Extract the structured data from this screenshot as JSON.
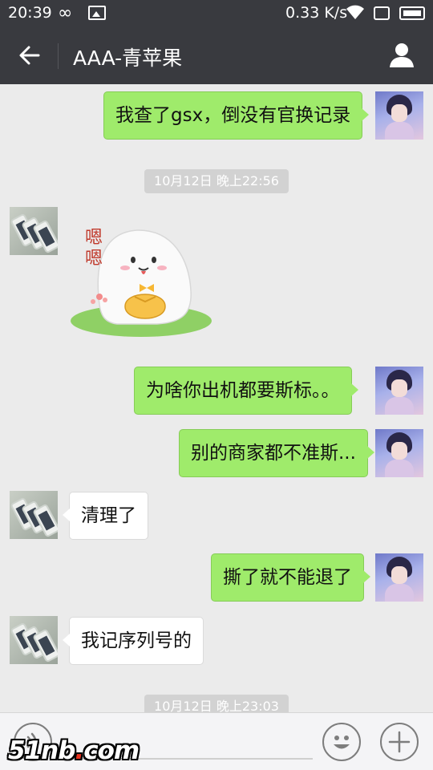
{
  "status_bar": {
    "time": "20:39",
    "network_speed": "0.33 K/s",
    "icons": [
      "infinity-icon",
      "gallery-icon",
      "wifi-icon",
      "screen-icon",
      "battery-icon"
    ]
  },
  "header": {
    "title": "AAA-青苹果",
    "back_icon": "arrow-left-icon",
    "profile_icon": "person-icon",
    "background": "#393a3f"
  },
  "messages": [
    {
      "side": "me",
      "text": "我查了gsx，倒没有官换记录"
    },
    {
      "side": "timestamp",
      "text": "10月12日 晚上22:56"
    },
    {
      "side": "other",
      "type": "sticker",
      "sticker_text": "嗯嗯"
    },
    {
      "side": "me",
      "text": "为啥你出机都要斯标。。"
    },
    {
      "side": "me",
      "text": "别的商家都不准斯..."
    },
    {
      "side": "other",
      "text": "清理了"
    },
    {
      "side": "me",
      "text": "撕了就不能退了"
    },
    {
      "side": "other",
      "text": "我记序列号的"
    },
    {
      "side": "timestamp",
      "text": "10月12日 晚上23:03"
    }
  ],
  "input_bar": {
    "icons": [
      "voice-icon",
      "emoji-icon",
      "plus-icon"
    ]
  },
  "watermark": {
    "part1": "51nb",
    "dot": ".",
    "part2": "com"
  },
  "colors": {
    "outgoing_bubble": "#9feb6b",
    "incoming_bubble": "#ffffff",
    "chat_background": "#ebebeb",
    "timestamp_bg": "#d2d2d2"
  }
}
